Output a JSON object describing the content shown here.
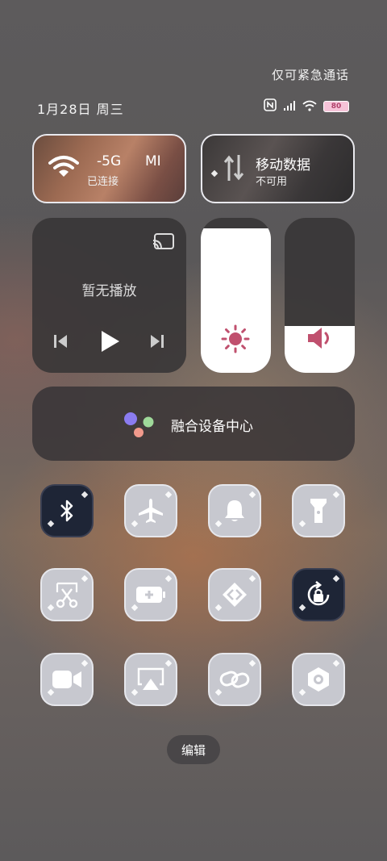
{
  "header": {
    "emergency_text": "仅可紧急通话",
    "date": "1月28日 周三",
    "battery_label": "80"
  },
  "wifi_tile": {
    "network_name": "-5G",
    "network_suffix": "MI",
    "status": "已连接",
    "icon": "wifi-icon"
  },
  "mobile_tile": {
    "label": "移动数据",
    "status": "不可用",
    "icon": "mobile-data-icon"
  },
  "media": {
    "status": "暂无播放",
    "cast_icon": "cast-icon"
  },
  "brightness": {
    "level": 0.93,
    "icon": "sun-icon"
  },
  "volume": {
    "level": 0.3,
    "icon": "speaker-icon"
  },
  "fusion": {
    "label": "融合设备中心"
  },
  "toggles": [
    {
      "name": "bluetooth",
      "icon": "bluetooth-icon",
      "on": true
    },
    {
      "name": "airplane",
      "icon": "airplane-icon",
      "on": false
    },
    {
      "name": "ringer",
      "icon": "bell-icon",
      "on": false
    },
    {
      "name": "flashlight",
      "icon": "flashlight-icon",
      "on": false
    },
    {
      "name": "screenshot",
      "icon": "scissors-icon",
      "on": false
    },
    {
      "name": "battery-saver",
      "icon": "battery-plus-icon",
      "on": false
    },
    {
      "name": "device-share",
      "icon": "share-arrows-icon",
      "on": false
    },
    {
      "name": "rotation-lock",
      "icon": "rotation-lock-icon",
      "on": true
    },
    {
      "name": "screen-record",
      "icon": "video-camera-icon",
      "on": false
    },
    {
      "name": "screen-cast",
      "icon": "screencast-icon",
      "on": false
    },
    {
      "name": "link",
      "icon": "link-icon",
      "on": false
    },
    {
      "name": "settings",
      "icon": "hexagon-gear-icon",
      "on": false
    }
  ],
  "footer": {
    "edit_label": "编辑"
  },
  "colors": {
    "accent_pink": "#c0506e",
    "active_tile": "#1e2536",
    "inactive_tile": "#c7c8cf"
  }
}
